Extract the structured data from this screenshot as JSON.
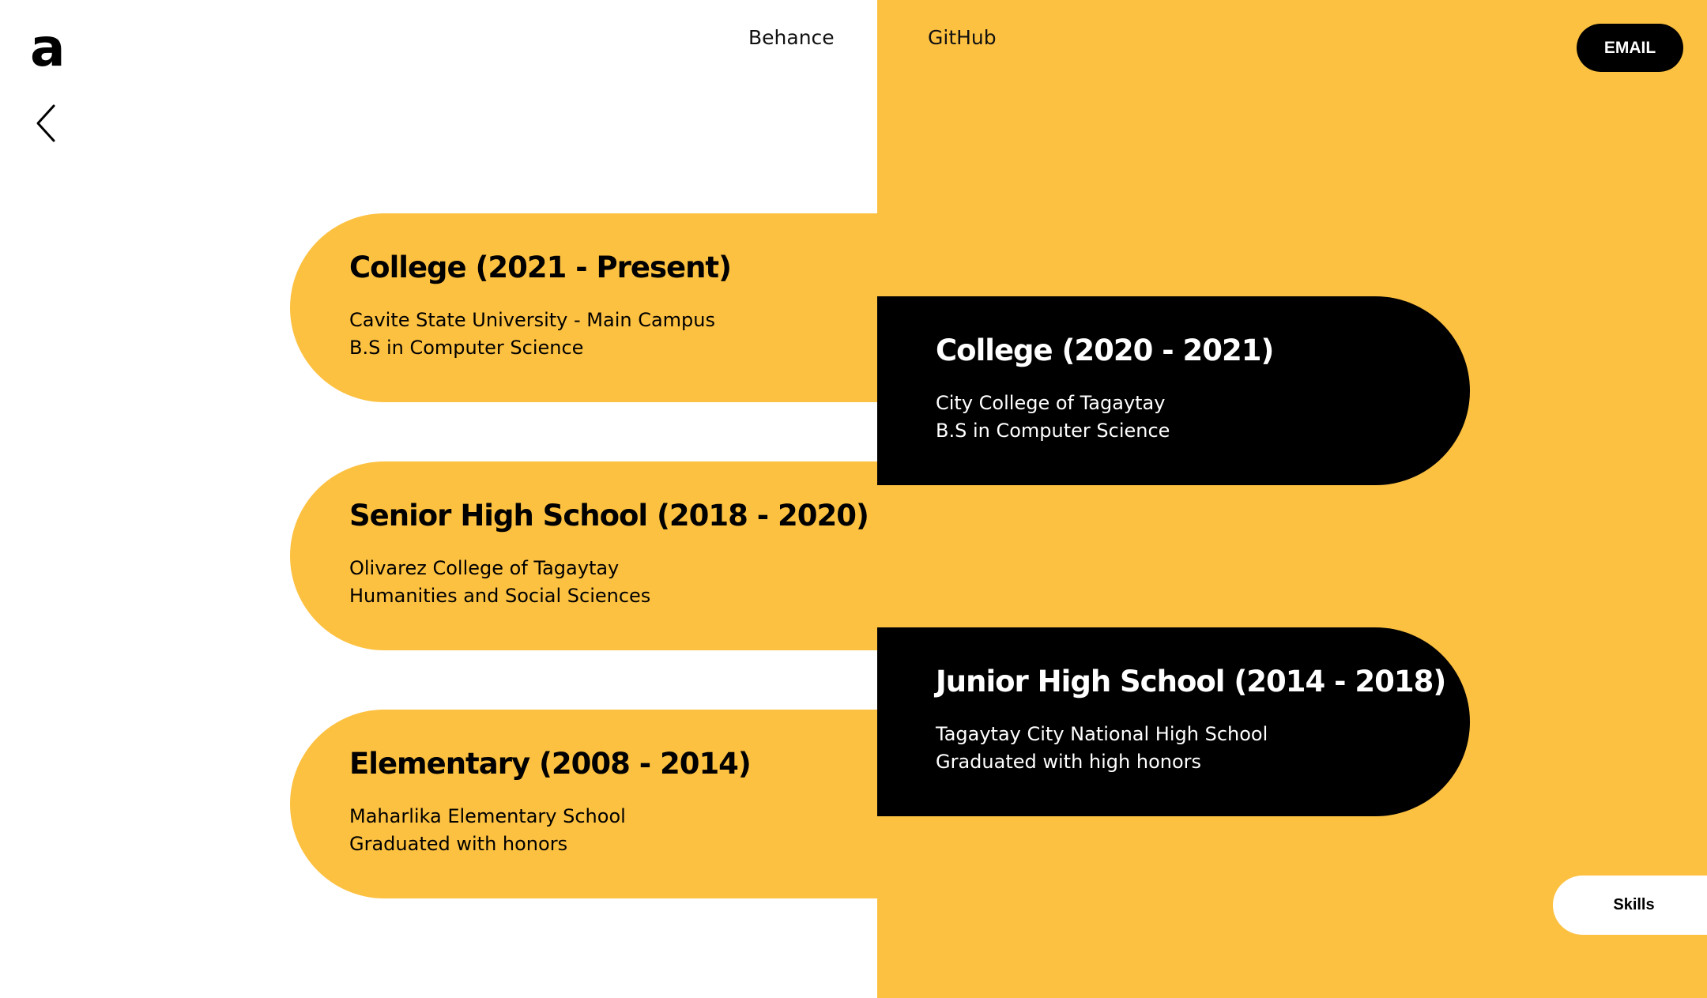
{
  "header": {
    "logo_text": "a",
    "nav": [
      {
        "label": "Behance"
      },
      {
        "label": "GitHub"
      }
    ],
    "email_label": "EMAIL"
  },
  "footer": {
    "skills_label": "Skills"
  },
  "colors": {
    "accent": "#FDC141",
    "dark": "#000000",
    "background": "#FFFFFF"
  },
  "education": [
    {
      "title": "College (2021 - Present)",
      "school": "Cavite State University - Main Campus",
      "detail": "B.S in Computer Science"
    },
    {
      "title": "College (2020 - 2021)",
      "school": "City College of Tagaytay",
      "detail": "B.S in Computer Science"
    },
    {
      "title": "Senior High School (2018 - 2020)",
      "school": "Olivarez College of Tagaytay",
      "detail": "Humanities and Social Sciences"
    },
    {
      "title": "Junior High School (2014 - 2018)",
      "school": "Tagaytay City National High School",
      "detail": "Graduated with high honors"
    },
    {
      "title": "Elementary (2008 - 2014)",
      "school": "Maharlika Elementary School",
      "detail": "Graduated with honors"
    }
  ],
  "icons": {
    "back": "chevron-left-icon"
  }
}
